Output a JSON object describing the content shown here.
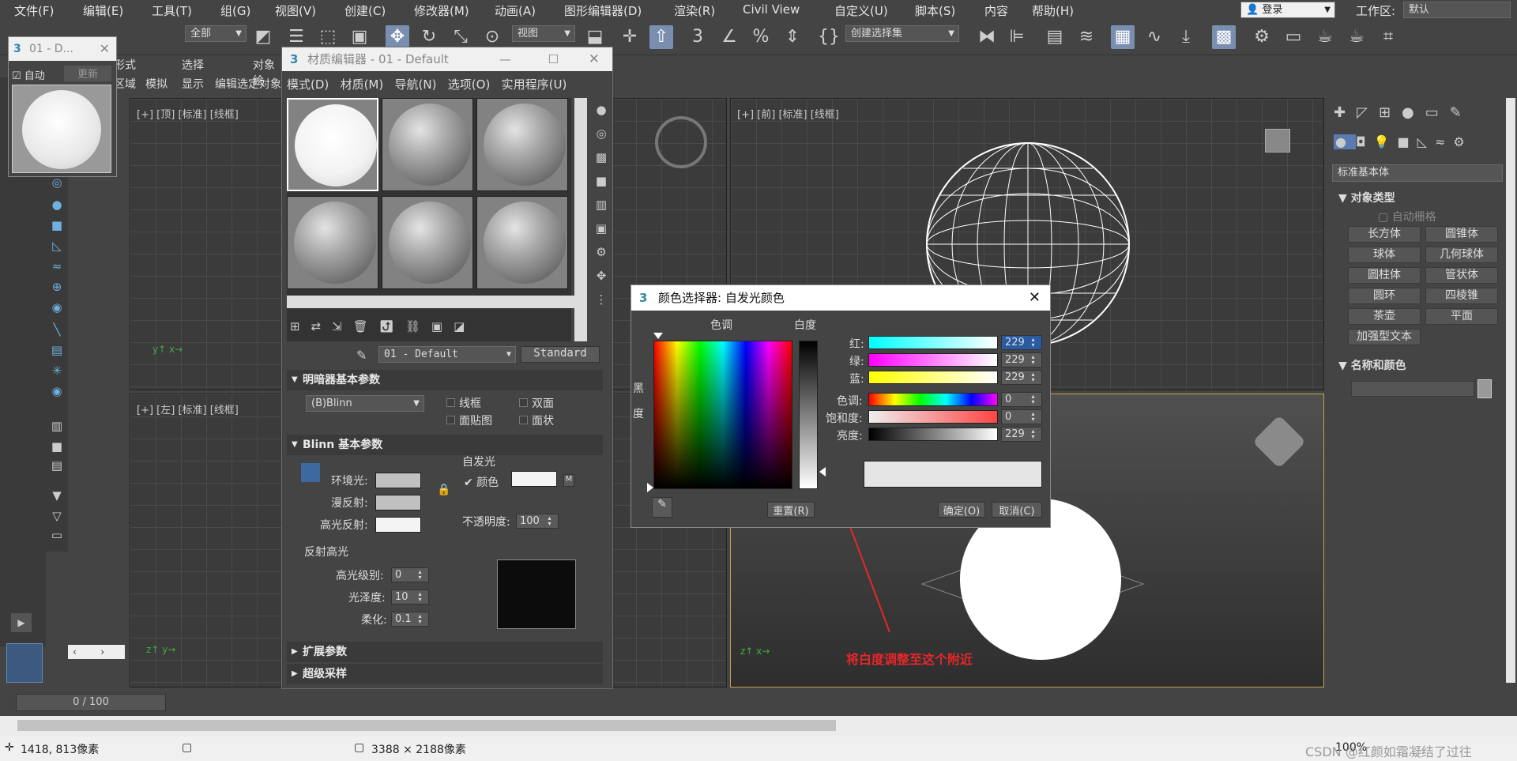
{
  "menu": [
    "文件(F)",
    "编辑(E)",
    "工具(T)",
    "组(G)",
    "视图(V)",
    "创建(C)",
    "修改器(M)",
    "动画(A)",
    "图形编辑器(D)",
    "渲染(R)",
    "Civil View",
    "自定义(U)",
    "脚本(S)",
    "内容",
    "帮助(H)"
  ],
  "account": {
    "label": "登录",
    "workspace_label": "工作区:",
    "workspace_value": "默认"
  },
  "toolbar": {
    "filter": "全部",
    "ref_coord": "视图",
    "named_selection": "创建选择集"
  },
  "ribbon": {
    "tabs": [
      "形式",
      "选择",
      "对象绘"
    ],
    "sub": [
      "区域",
      "模拟",
      "显示",
      "编辑选定对象"
    ]
  },
  "small_window": {
    "title": "01 - D...",
    "auto": "自动",
    "update": "更新"
  },
  "viewports": {
    "top": "[+] [顶] [标准] [线框]",
    "front": "[+] [前] [标准] [线框]",
    "left": "[+] [左] [标准] [线框]"
  },
  "mated": {
    "title": "材质编辑器 - 01 - Default",
    "menu": [
      "模式(D)",
      "材质(M)",
      "导航(N)",
      "选项(O)",
      "实用程序(U)"
    ],
    "material_name": "01 - Default",
    "material_type": "Standard",
    "shader_section": "明暗器基本参数",
    "shader": "(B)Blinn",
    "shader_opts": [
      "线框",
      "双面",
      "面贴图",
      "面状"
    ],
    "blinn_section": "Blinn 基本参数",
    "self_illum": "自发光",
    "self_illum_color": "颜色",
    "ambient": "环境光:",
    "diffuse": "漫反射:",
    "specular": "高光反射:",
    "opacity_label": "不透明度:",
    "opacity": "100",
    "highlight_section": "反射高光",
    "spec_level_label": "高光级别:",
    "spec_level": "0",
    "gloss_label": "光泽度:",
    "gloss": "10",
    "soften_label": "柔化:",
    "soften": "0.1",
    "ext_section": "扩展参数",
    "super_section": "超级采样",
    "map_m": "M"
  },
  "color_picker": {
    "title": "颜色选择器: 自发光颜色",
    "hue_label": "色调",
    "white_label": "白度",
    "black_label": "黑",
    "black_label2": "度",
    "r_label": "红:",
    "r": "229",
    "g_label": "绿:",
    "g": "229",
    "b_label": "蓝:",
    "b": "229",
    "h_label": "色调:",
    "h": "0",
    "s_label": "饱和度:",
    "s": "0",
    "v_label": "亮度:",
    "v": "229",
    "reset": "重置(R)",
    "ok": "确定(O)",
    "cancel": "取消(C)"
  },
  "annotation": "将白度调整至这个附近",
  "command_panel": {
    "category": "标准基本体",
    "object_type": "对象类型",
    "autogrid": "自动栅格",
    "buttons": [
      "长方体",
      "圆锥体",
      "球体",
      "几何球体",
      "圆柱体",
      "管状体",
      "圆环",
      "四棱锥",
      "茶壶",
      "平面",
      "加强型文本"
    ],
    "name_color": "名称和颜色"
  },
  "timeline": {
    "frame": "0 / 100"
  },
  "status": {
    "coords": "1418, 813像素",
    "dims": "3388 × 2188像素",
    "zoom": "100%",
    "watermark": "CSDN @红颜如霜凝结了过往"
  },
  "colors": {
    "accent": "#7a8fb0",
    "annotation": "#e8262a"
  }
}
